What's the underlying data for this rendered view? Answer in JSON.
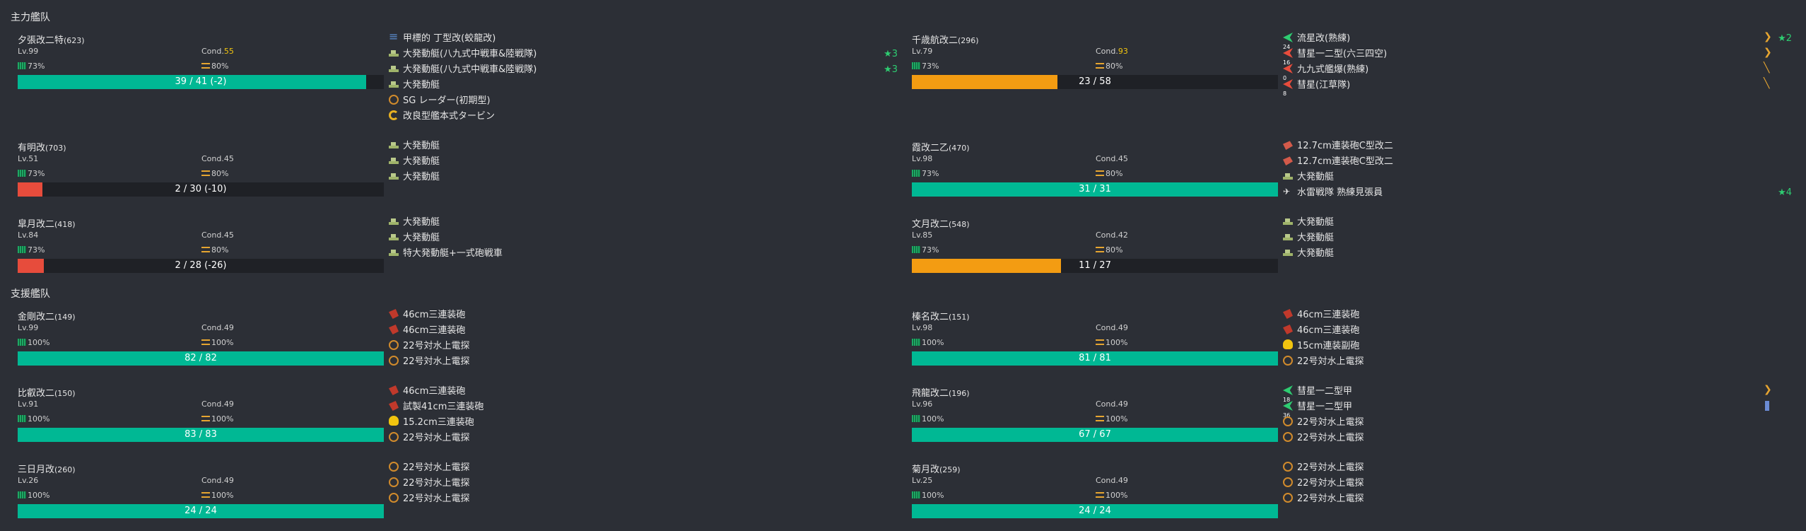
{
  "fleets": [
    {
      "title": "主力艦队",
      "ships": [
        {
          "name": "夕張改二特",
          "id": "(623)",
          "lv": "Lv.99",
          "cond_label": "Cond.",
          "cond": "55",
          "cond_hi": true,
          "fuel": "73%",
          "ammo": "80%",
          "hp": "39 / 41 (-2)",
          "hp_frac": 0.951,
          "hp_color": "#00b894",
          "equip": [
            {
              "icon": "searchlight",
              "name": "甲標的 丁型改(蛟龍改)"
            },
            {
              "icon": "landing",
              "name": "大発動艇(八九式中戦車&陸戦隊)",
              "prof": "★3"
            },
            {
              "icon": "landing",
              "name": "大発動艇(八九式中戦車&陸戦隊)",
              "prof": "★3"
            },
            {
              "icon": "landing",
              "name": "大発動艇"
            },
            {
              "icon": "radar",
              "name": "SG レーダー(初期型)"
            },
            {
              "icon": "turbine",
              "name": "改良型艦本式タービン"
            }
          ]
        },
        {
          "name": "千歳航改二",
          "id": "(296)",
          "lv": "Lv.79",
          "cond_label": "Cond.",
          "cond": "93",
          "cond_hi": true,
          "fuel": "73%",
          "ammo": "80%",
          "hp": "23 / 58",
          "hp_frac": 0.397,
          "hp_color": "#f39c12",
          "equip": [
            {
              "icon": "plane-g",
              "name": "流星改(熟練)",
              "slot": "24",
              "prof": "★2"
            },
            {
              "icon": "plane-r",
              "name": "彗星一二型(六三四空)",
              "slot": "16"
            },
            {
              "icon": "plane-r",
              "name": "九九式艦爆(熟練)",
              "slot": "0"
            },
            {
              "icon": "plane-r",
              "name": "彗星(江草隊)",
              "slot": "8"
            }
          ]
        },
        {
          "name": "有明改",
          "id": "(703)",
          "lv": "Lv.51",
          "cond_label": "Cond.",
          "cond": "45",
          "fuel": "73%",
          "ammo": "80%",
          "hp": "2 / 30 (-10)",
          "hp_frac": 0.067,
          "hp_color": "#e74c3c",
          "short": true,
          "equip": [
            {
              "icon": "landing",
              "name": "大発動艇"
            },
            {
              "icon": "landing",
              "name": "大発動艇"
            },
            {
              "icon": "landing",
              "name": "大発動艇"
            }
          ]
        },
        {
          "name": "霞改二乙",
          "id": "(470)",
          "lv": "Lv.98",
          "cond_label": "Cond.",
          "cond": "45",
          "fuel": "73%",
          "ammo": "80%",
          "hp": "31 / 31",
          "hp_frac": 1.0,
          "hp_color": "#00b894",
          "equip": [
            {
              "icon": "maingun",
              "name": "12.7cm連装砲C型改二"
            },
            {
              "icon": "maingun",
              "name": "12.7cm連装砲C型改二"
            },
            {
              "icon": "landing",
              "name": "大発動艇"
            },
            {
              "icon": "seaplane",
              "name": "水雷戦隊 熟練見張員",
              "prof": "★4"
            }
          ]
        },
        {
          "name": "皐月改二",
          "id": "(418)",
          "lv": "Lv.84",
          "cond_label": "Cond.",
          "cond": "45",
          "fuel": "73%",
          "ammo": "80%",
          "hp": "2 / 28 (-26)",
          "hp_frac": 0.071,
          "hp_color": "#e74c3c",
          "equip": [
            {
              "icon": "landing",
              "name": "大発動艇"
            },
            {
              "icon": "landing",
              "name": "大発動艇"
            },
            {
              "icon": "landing",
              "name": "特大発動艇+一式砲戦車"
            }
          ]
        },
        {
          "name": "文月改二",
          "id": "(548)",
          "lv": "Lv.85",
          "cond_label": "Cond.",
          "cond": "42",
          "fuel": "73%",
          "ammo": "80%",
          "hp": "11 / 27",
          "hp_frac": 0.407,
          "hp_color": "#f39c12",
          "equip": [
            {
              "icon": "landing",
              "name": "大発動艇"
            },
            {
              "icon": "landing",
              "name": "大発動艇"
            },
            {
              "icon": "landing",
              "name": "大発動艇"
            }
          ]
        }
      ]
    },
    {
      "title": "支援艦队",
      "ships": [
        {
          "name": "金剛改二",
          "id": "(149)",
          "lv": "Lv.99",
          "cond_label": "Cond.",
          "cond": "49",
          "fuel": "100%",
          "ammo": "100%",
          "hp": "82 / 82",
          "hp_frac": 1.0,
          "hp_color": "#00b894",
          "equip": [
            {
              "icon": "mainbig",
              "name": "46cm三連装砲"
            },
            {
              "icon": "mainbig",
              "name": "46cm三連装砲"
            },
            {
              "icon": "radar",
              "name": "22号対水上電探"
            },
            {
              "icon": "radar",
              "name": "22号対水上電探"
            }
          ]
        },
        {
          "name": "榛名改二",
          "id": "(151)",
          "lv": "Lv.98",
          "cond_label": "Cond.",
          "cond": "49",
          "fuel": "100%",
          "ammo": "100%",
          "hp": "81 / 81",
          "hp_frac": 1.0,
          "hp_color": "#00b894",
          "equip": [
            {
              "icon": "mainbig",
              "name": "46cm三連装砲"
            },
            {
              "icon": "mainbig",
              "name": "46cm三連装砲"
            },
            {
              "icon": "secondary",
              "name": "15cm連装副砲"
            },
            {
              "icon": "radar",
              "name": "22号対水上電探"
            }
          ]
        },
        {
          "name": "比叡改二",
          "id": "(150)",
          "lv": "Lv.91",
          "cond_label": "Cond.",
          "cond": "49",
          "fuel": "100%",
          "ammo": "100%",
          "hp": "83 / 83",
          "hp_frac": 1.0,
          "hp_color": "#00b894",
          "equip": [
            {
              "icon": "mainbig",
              "name": "46cm三連装砲"
            },
            {
              "icon": "mainbig",
              "name": "試製41cm三連装砲"
            },
            {
              "icon": "secondary",
              "name": "15.2cm三連装砲"
            },
            {
              "icon": "radar",
              "name": "22号対水上電探"
            }
          ]
        },
        {
          "name": "飛龍改二",
          "id": "(196)",
          "lv": "Lv.96",
          "cond_label": "Cond.",
          "cond": "49",
          "fuel": "100%",
          "ammo": "100%",
          "hp": "67 / 67",
          "hp_frac": 1.0,
          "hp_color": "#00b894",
          "equip": [
            {
              "icon": "plane-g",
              "name": "彗星一二型甲",
              "slot": "18"
            },
            {
              "icon": "plane-g",
              "name": "彗星一二型甲",
              "slot": "36"
            },
            {
              "icon": "radar",
              "name": "22号対水上電探"
            },
            {
              "icon": "radar",
              "name": "22号対水上電探"
            }
          ]
        },
        {
          "name": "三日月改",
          "id": "(260)",
          "lv": "Lv.26",
          "cond_label": "Cond.",
          "cond": "49",
          "fuel": "100%",
          "ammo": "100%",
          "hp": "24 / 24",
          "hp_frac": 1.0,
          "hp_color": "#00b894",
          "equip": [
            {
              "icon": "radar",
              "name": "22号対水上電探"
            },
            {
              "icon": "radar",
              "name": "22号対水上電探"
            },
            {
              "icon": "radar",
              "name": "22号対水上電探"
            }
          ]
        },
        {
          "name": "菊月改",
          "id": "(259)",
          "lv": "Lv.25",
          "cond_label": "Cond.",
          "cond": "49",
          "fuel": "100%",
          "ammo": "100%",
          "hp": "24 / 24",
          "hp_frac": 1.0,
          "hp_color": "#00b894",
          "equip": [
            {
              "icon": "radar",
              "name": "22号対水上電探"
            },
            {
              "icon": "radar",
              "name": "22号対水上電探"
            },
            {
              "icon": "radar",
              "name": "22号対水上電探"
            }
          ]
        }
      ]
    }
  ]
}
